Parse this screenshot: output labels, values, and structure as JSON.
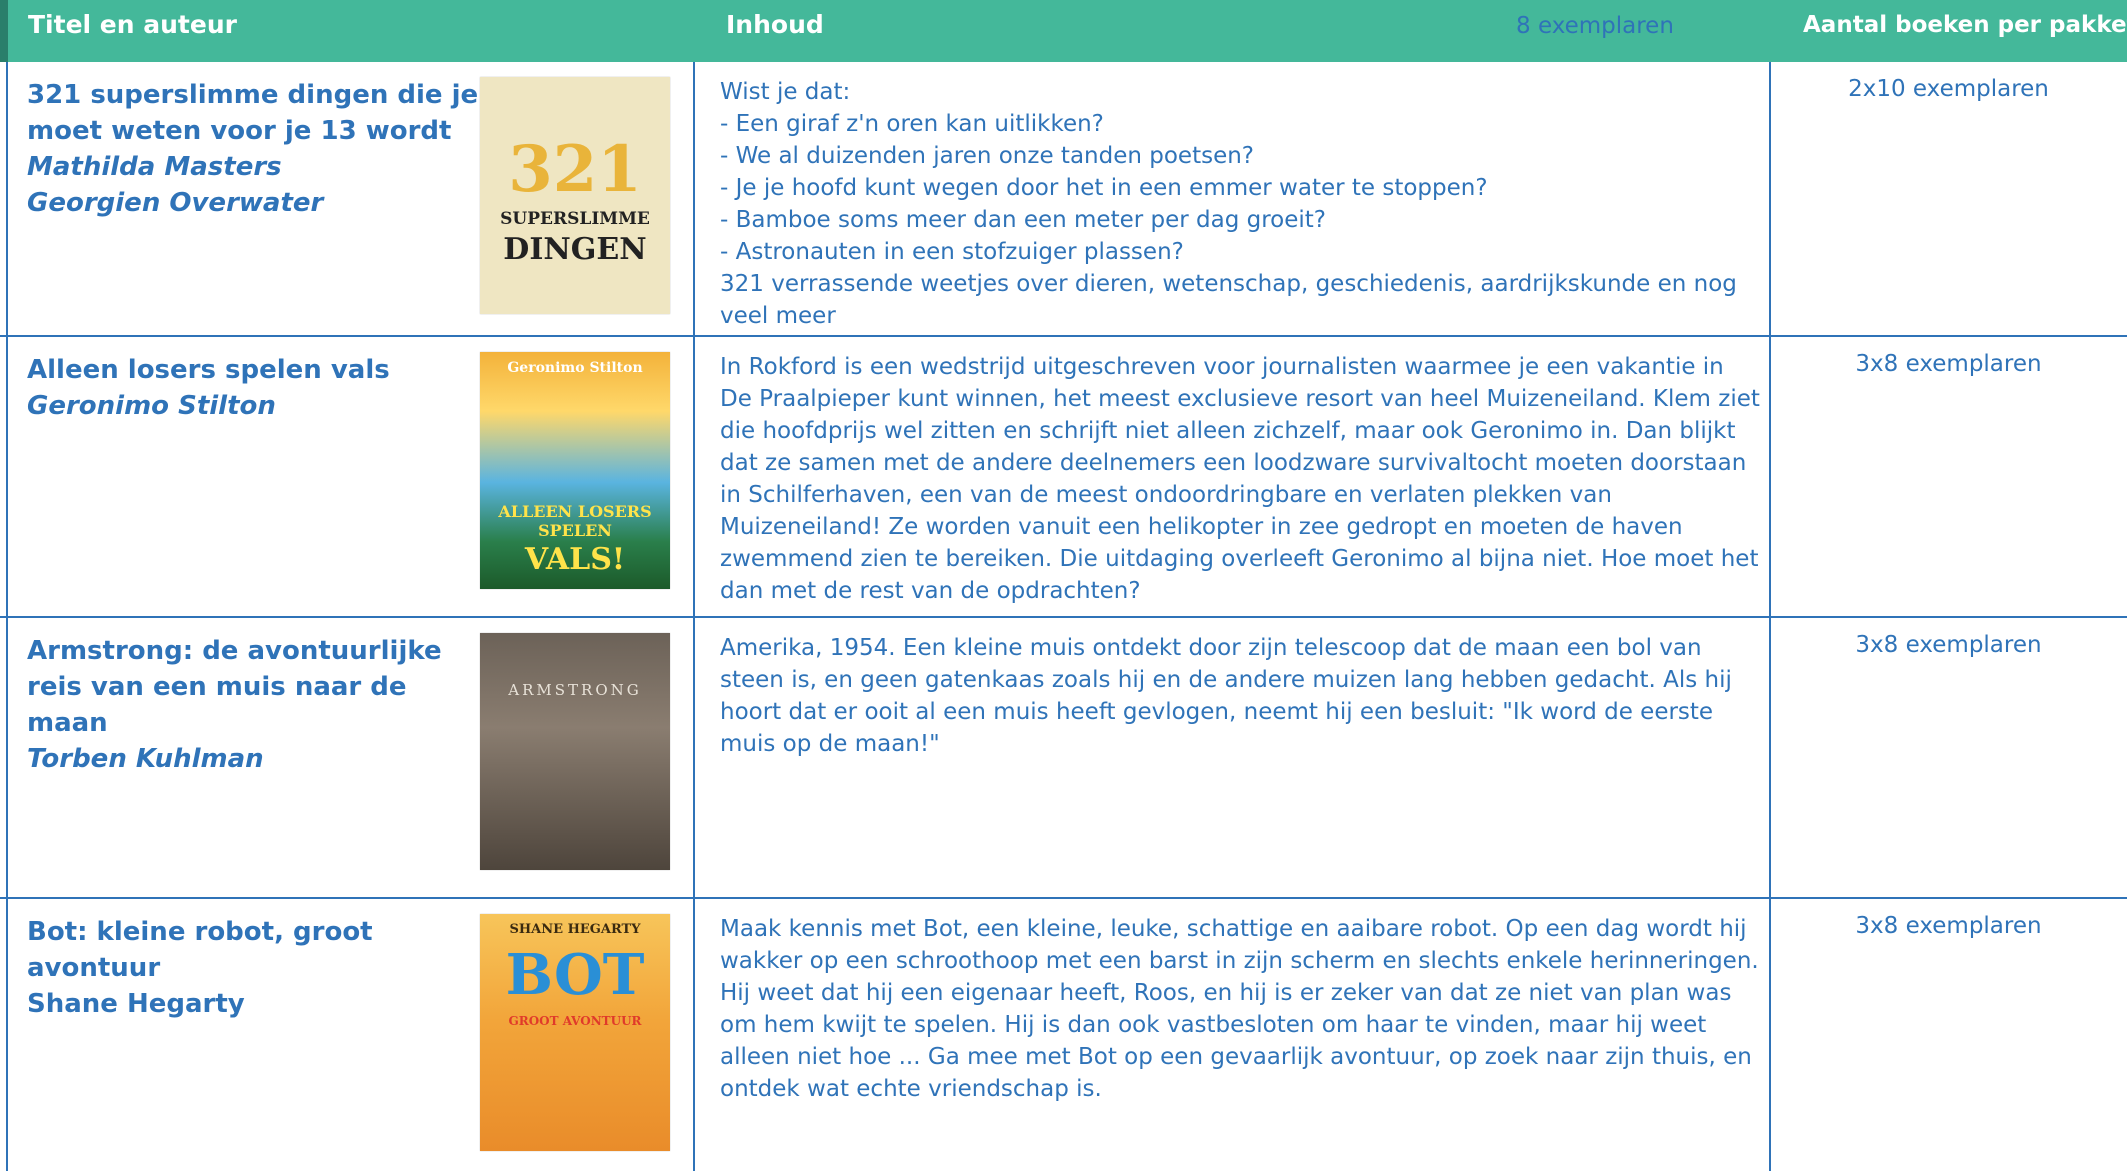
{
  "header": {
    "title_author": "Titel en auteur",
    "content": "Inhoud",
    "copies_note": "8 exemplaren",
    "per_package": "Aantal boeken per pakket"
  },
  "books": [
    {
      "title": "321 superslimme dingen die je moet weten voor je 13 wordt",
      "authors": [
        "Mathilda Masters",
        "Georgien Overwater"
      ],
      "cover": {
        "line1": "321",
        "line2": "SUPERSLIMME",
        "line3": "DINGEN"
      },
      "description": [
        "Wist je dat:",
        "- Een giraf z'n oren kan uitlikken?",
        "- We al duizenden jaren onze tanden poetsen?",
        "- Je je hoofd kunt wegen door het in een emmer water te stoppen?",
        "- Bamboe soms meer dan een meter per dag groeit?",
        "- Astronauten in een stofzuiger plassen?",
        "321 verrassende weetjes over dieren, wetenschap, geschiedenis, aardrijkskunde en nog veel meer"
      ],
      "count": "2x10 exemplaren"
    },
    {
      "title": "Alleen losers spelen vals",
      "authors": [
        "Geronimo Stilton"
      ],
      "cover": {
        "line1": "Geronimo Stilton",
        "line2": "ALLEEN LOSERS SPELEN",
        "line3": "VALS!"
      },
      "description": [
        "In Rokford is een wedstrijd uitgeschreven voor journalisten waarmee je een vakantie in De Praalpieper kunt winnen, het meest exclusieve resort van heel Muizeneiland. Klem ziet die hoofdprijs wel zitten en schrijft niet alleen zichzelf, maar ook Geronimo in. Dan blijkt dat ze samen met de andere deelnemers een loodzware survivaltocht moeten doorstaan in Schilferhaven, een van de meest ondoordringbare en verlaten plekken van Muizeneiland! Ze worden vanuit een helikopter in zee gedropt en moeten de haven zwemmend zien te bereiken. Die uitdaging overleeft Geronimo al bijna niet. Hoe moet het dan met de rest van de opdrachten?"
      ],
      "count": "3x8 exemplaren"
    },
    {
      "title": "Armstrong: de avontuurlijke reis van een muis naar de maan",
      "authors": [
        "Torben Kuhlman"
      ],
      "cover": {
        "line1": "ARMSTRONG",
        "line2": "",
        "line3": ""
      },
      "description": [
        "Amerika, 1954. Een kleine muis ontdekt door zijn telescoop dat de maan een bol van steen is, en geen gatenkaas zoals hij en de andere muizen lang hebben gedacht. Als hij hoort dat er ooit al een muis heeft gevlogen, neemt hij een besluit: \"Ik word de eerste muis op de maan!\""
      ],
      "count": "3x8 exemplaren"
    },
    {
      "title": "Bot: kleine robot, groot avontuur",
      "authors": [
        "Shane Hegarty"
      ],
      "cover": {
        "line1": "SHANE HEGARTY",
        "line2": "BOT",
        "line3": "GROOT AVONTUUR"
      },
      "description": [
        "Maak kennis met Bot, een kleine, leuke, schattige en aaibare robot. Op een dag wordt hij wakker op een schroothoop met een barst in zijn scherm en slechts enkele herinneringen. Hij weet dat hij een eigenaar heeft, Roos, en hij is er zeker van dat ze niet van plan was om hem kwijt te spelen. Hij is dan ook vastbesloten om haar te vinden, maar hij weet alleen niet hoe ... Ga mee met Bot op een gevaarlijk avontuur, op zoek naar zijn thuis, en ontdek wat echte vriendschap is."
      ],
      "count": "3x8 exemplaren"
    }
  ]
}
